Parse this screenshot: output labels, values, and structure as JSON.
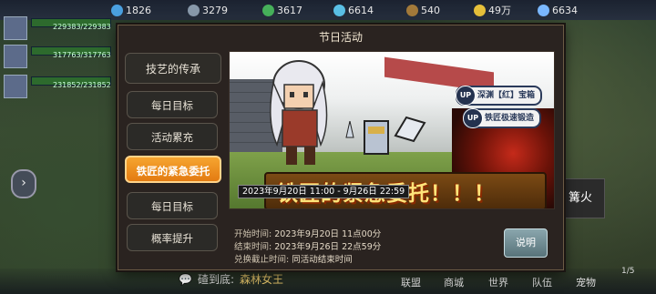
{
  "resources": [
    {
      "icon": "blue-gem-icon",
      "value": "1826",
      "color": "#4aa0e0"
    },
    {
      "icon": "ore-icon",
      "value": "3279",
      "color": "#8899aa"
    },
    {
      "icon": "leaf-icon",
      "value": "3617",
      "color": "#46b05a"
    },
    {
      "icon": "crystal-icon",
      "value": "6614",
      "color": "#5ac0e6"
    },
    {
      "icon": "wood-icon",
      "value": "540",
      "color": "#a37a3a"
    },
    {
      "icon": "coin-icon",
      "value": "49万",
      "color": "#e6c03a"
    },
    {
      "icon": "diamond-icon",
      "value": "6634",
      "color": "#7ab8ff"
    }
  ],
  "party": [
    {
      "hp": "229383/229383"
    },
    {
      "hp": "317763/317763"
    },
    {
      "hp": "231852/231852"
    }
  ],
  "dialog": {
    "title": "节日活动",
    "tabs": [
      {
        "label": "技艺的传承"
      },
      {
        "label": "每日目标"
      },
      {
        "label": "活动累充"
      },
      {
        "label": "铁匠的紧急委托",
        "active": true
      },
      {
        "label": "每日目标"
      },
      {
        "label": "概率提升"
      }
    ],
    "banner": {
      "date_range": "2023年9月20日 11:00 - 9月26日 22:59",
      "title": "铁匠的紧急委托！！！",
      "up_badge": "UP",
      "up1": "深渊【红】宝箱",
      "up2": "铁匠极速锻造"
    },
    "info": {
      "start_label": "开始时间:",
      "start_value": "2023年9月20日 11点00分",
      "end_label": "结束时间:",
      "end_value": "2023年9月26日 22点59分",
      "exchange_label": "兑换截止时间:",
      "exchange_value": "同活动结束时间"
    },
    "explain_button": "说明"
  },
  "side_button": "篝火",
  "chat": {
    "prefix": "碴到底:",
    "name": "森林女王"
  },
  "bottom_nav": [
    "联盟",
    "商城",
    "世界",
    "队伍",
    "宠物"
  ],
  "page_indicator": "1/5"
}
